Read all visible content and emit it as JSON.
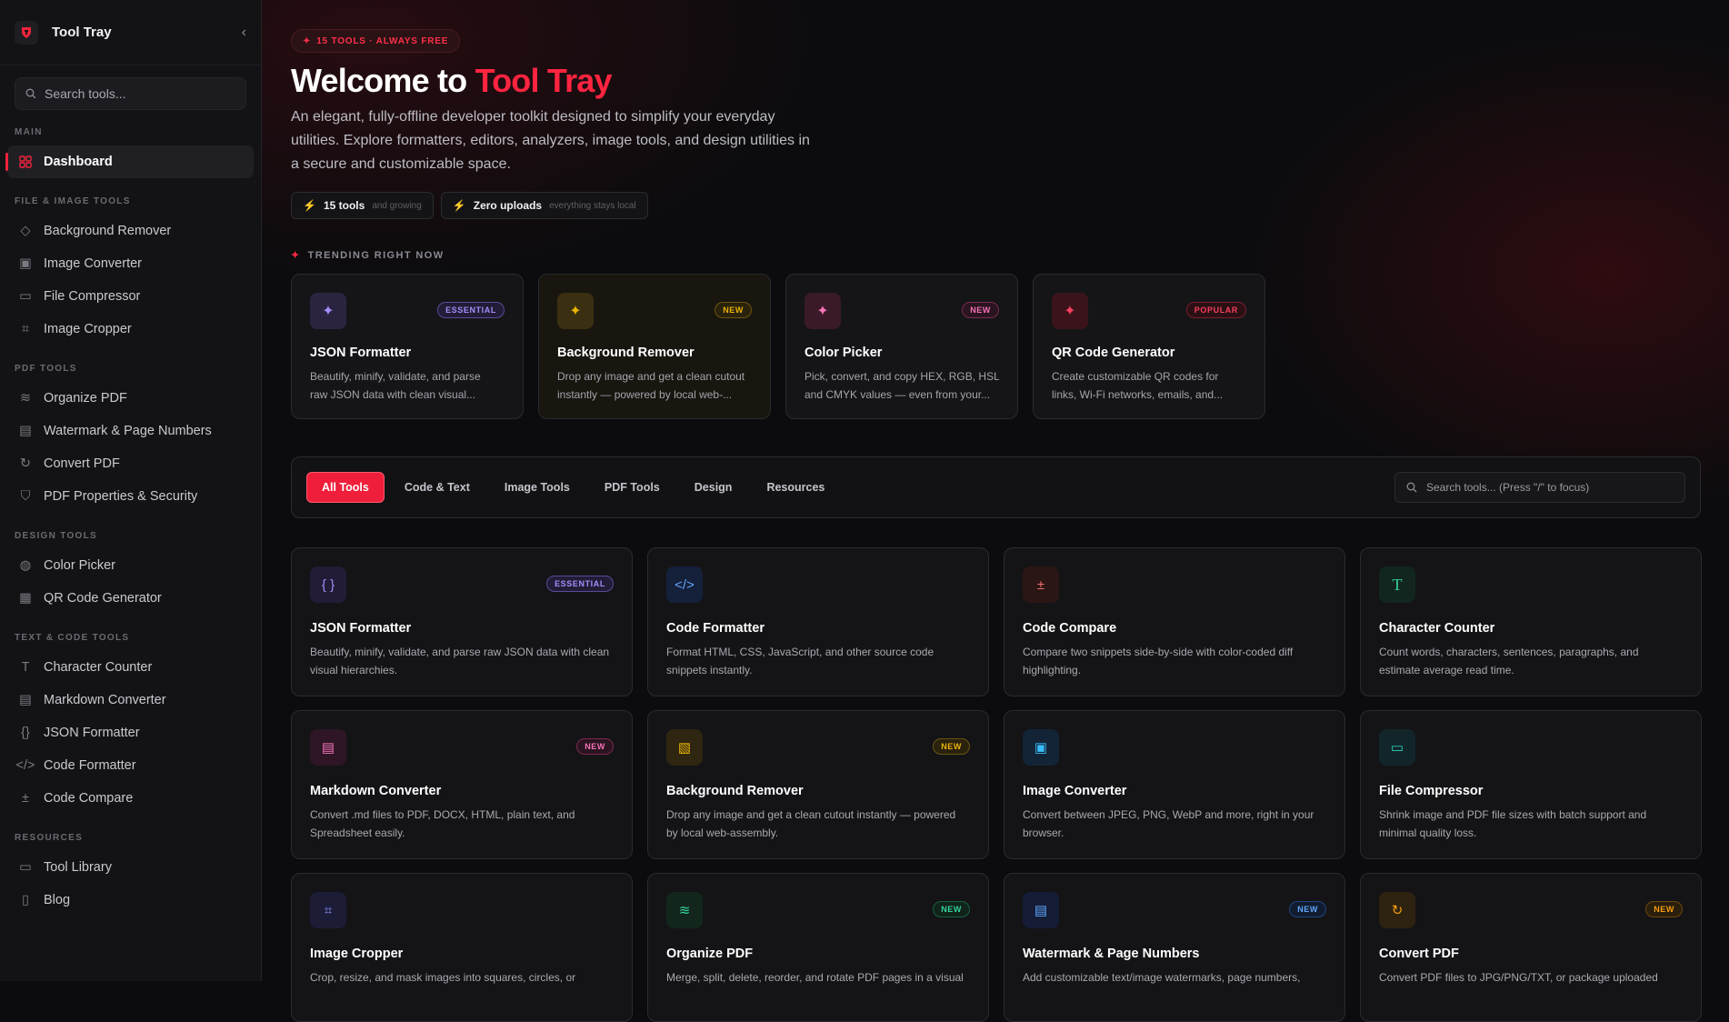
{
  "sidebar": {
    "brand": "Tool Tray",
    "search_placeholder": "Search tools...",
    "sections": {
      "main": "MAIN",
      "file": "FILE & IMAGE TOOLS",
      "pdf": "PDF TOOLS",
      "design": "DESIGN TOOLS",
      "text": "TEXT & CODE TOOLS",
      "resources": "RESOURCES"
    },
    "dashboard": "Dashboard",
    "file_items": [
      "Background Remover",
      "Image Converter",
      "File Compressor",
      "Image Cropper"
    ],
    "pdf_items": [
      "Organize PDF",
      "Watermark & Page Numbers",
      "Convert PDF",
      "PDF Properties & Security"
    ],
    "design_items": [
      "Color Picker",
      "QR Code Generator"
    ],
    "text_items": [
      "Character Counter",
      "Markdown Converter",
      "JSON Formatter",
      "Code Formatter",
      "Code Compare"
    ],
    "resource_items": [
      "Tool Library",
      "Blog"
    ]
  },
  "hero": {
    "badge": "15 TOOLS · ALWAYS FREE",
    "title_prefix": "Welcome to ",
    "title_accent": "Tool Tray",
    "description": "An elegant, fully-offline developer toolkit designed to simplify your everyday utilities. Explore formatters, editors, analyzers, image tools, and design utilities in a secure and customizable space.",
    "pill1_bold": "15 tools",
    "pill1_small": "and growing",
    "pill2_bold": "Zero uploads",
    "pill2_small": "everything stays local"
  },
  "trending": {
    "heading": "TRENDING RIGHT NOW",
    "cards": [
      {
        "title": "JSON Formatter",
        "tag": "ESSENTIAL",
        "desc1": "Beautify, minify, validate, and parse",
        "desc2": "raw JSON data with clean visual..."
      },
      {
        "title": "Background Remover",
        "tag": "NEW",
        "desc1": "Drop any image and get a clean cutout",
        "desc2": "instantly — powered by local web-..."
      },
      {
        "title": "Color Picker",
        "tag": "NEW",
        "desc1": "Pick, convert, and copy HEX, RGB, HSL",
        "desc2": "and CMYK values — even from your..."
      },
      {
        "title": "QR Code Generator",
        "tag": "POPULAR",
        "desc1": "Create customizable QR codes for",
        "desc2": "links, Wi-Fi networks, emails, and..."
      }
    ]
  },
  "filter": {
    "tabs": [
      "All Tools",
      "Code & Text",
      "Image Tools",
      "PDF Tools",
      "Design",
      "Resources"
    ],
    "search_placeholder": "Search tools... (Press \"/\" to focus)"
  },
  "grid": [
    {
      "title": "JSON Formatter",
      "tag": "ESSENTIAL",
      "desc": "Beautify, minify, validate, and parse raw JSON data with clean visual hierarchies."
    },
    {
      "title": "Code Formatter",
      "tag": "",
      "desc": "Format HTML, CSS, JavaScript, and other source code snippets instantly."
    },
    {
      "title": "Code Compare",
      "tag": "",
      "desc": "Compare two snippets side-by-side with color-coded diff highlighting."
    },
    {
      "title": "Character Counter",
      "tag": "",
      "desc": "Count words, characters, sentences, paragraphs, and estimate average read time."
    },
    {
      "title": "Markdown Converter",
      "tag": "NEW",
      "desc": "Convert .md files to PDF, DOCX, HTML, plain text, and Spreadsheet easily."
    },
    {
      "title": "Background Remover",
      "tag": "NEW",
      "desc": "Drop any image and get a clean cutout instantly — powered by local web-assembly."
    },
    {
      "title": "Image Converter",
      "tag": "",
      "desc": "Convert between JPEG, PNG, WebP and more, right in your browser."
    },
    {
      "title": "File Compressor",
      "tag": "",
      "desc": "Shrink image and PDF file sizes with batch support and minimal quality loss."
    },
    {
      "title": "Image Cropper",
      "tag": "",
      "desc": "Crop, resize, and mask images into squares, circles, or"
    },
    {
      "title": "Organize PDF",
      "tag": "NEW",
      "desc": "Merge, split, delete, reorder, and rotate PDF pages in a visual"
    },
    {
      "title": "Watermark & Page Numbers",
      "tag": "NEW",
      "desc": "Add customizable text/image watermarks, page numbers,"
    },
    {
      "title": "Convert PDF",
      "tag": "NEW",
      "desc": "Convert PDF files to JPG/PNG/TXT, or package uploaded"
    }
  ],
  "colors": {
    "accent": "#ef233c",
    "purple": "#8b5cf6",
    "yellow": "#eab308",
    "pink": "#ec4899",
    "teal": "#14b8a6",
    "blue": "#3b82f6",
    "green": "#10b981",
    "orange": "#f59e0b"
  }
}
